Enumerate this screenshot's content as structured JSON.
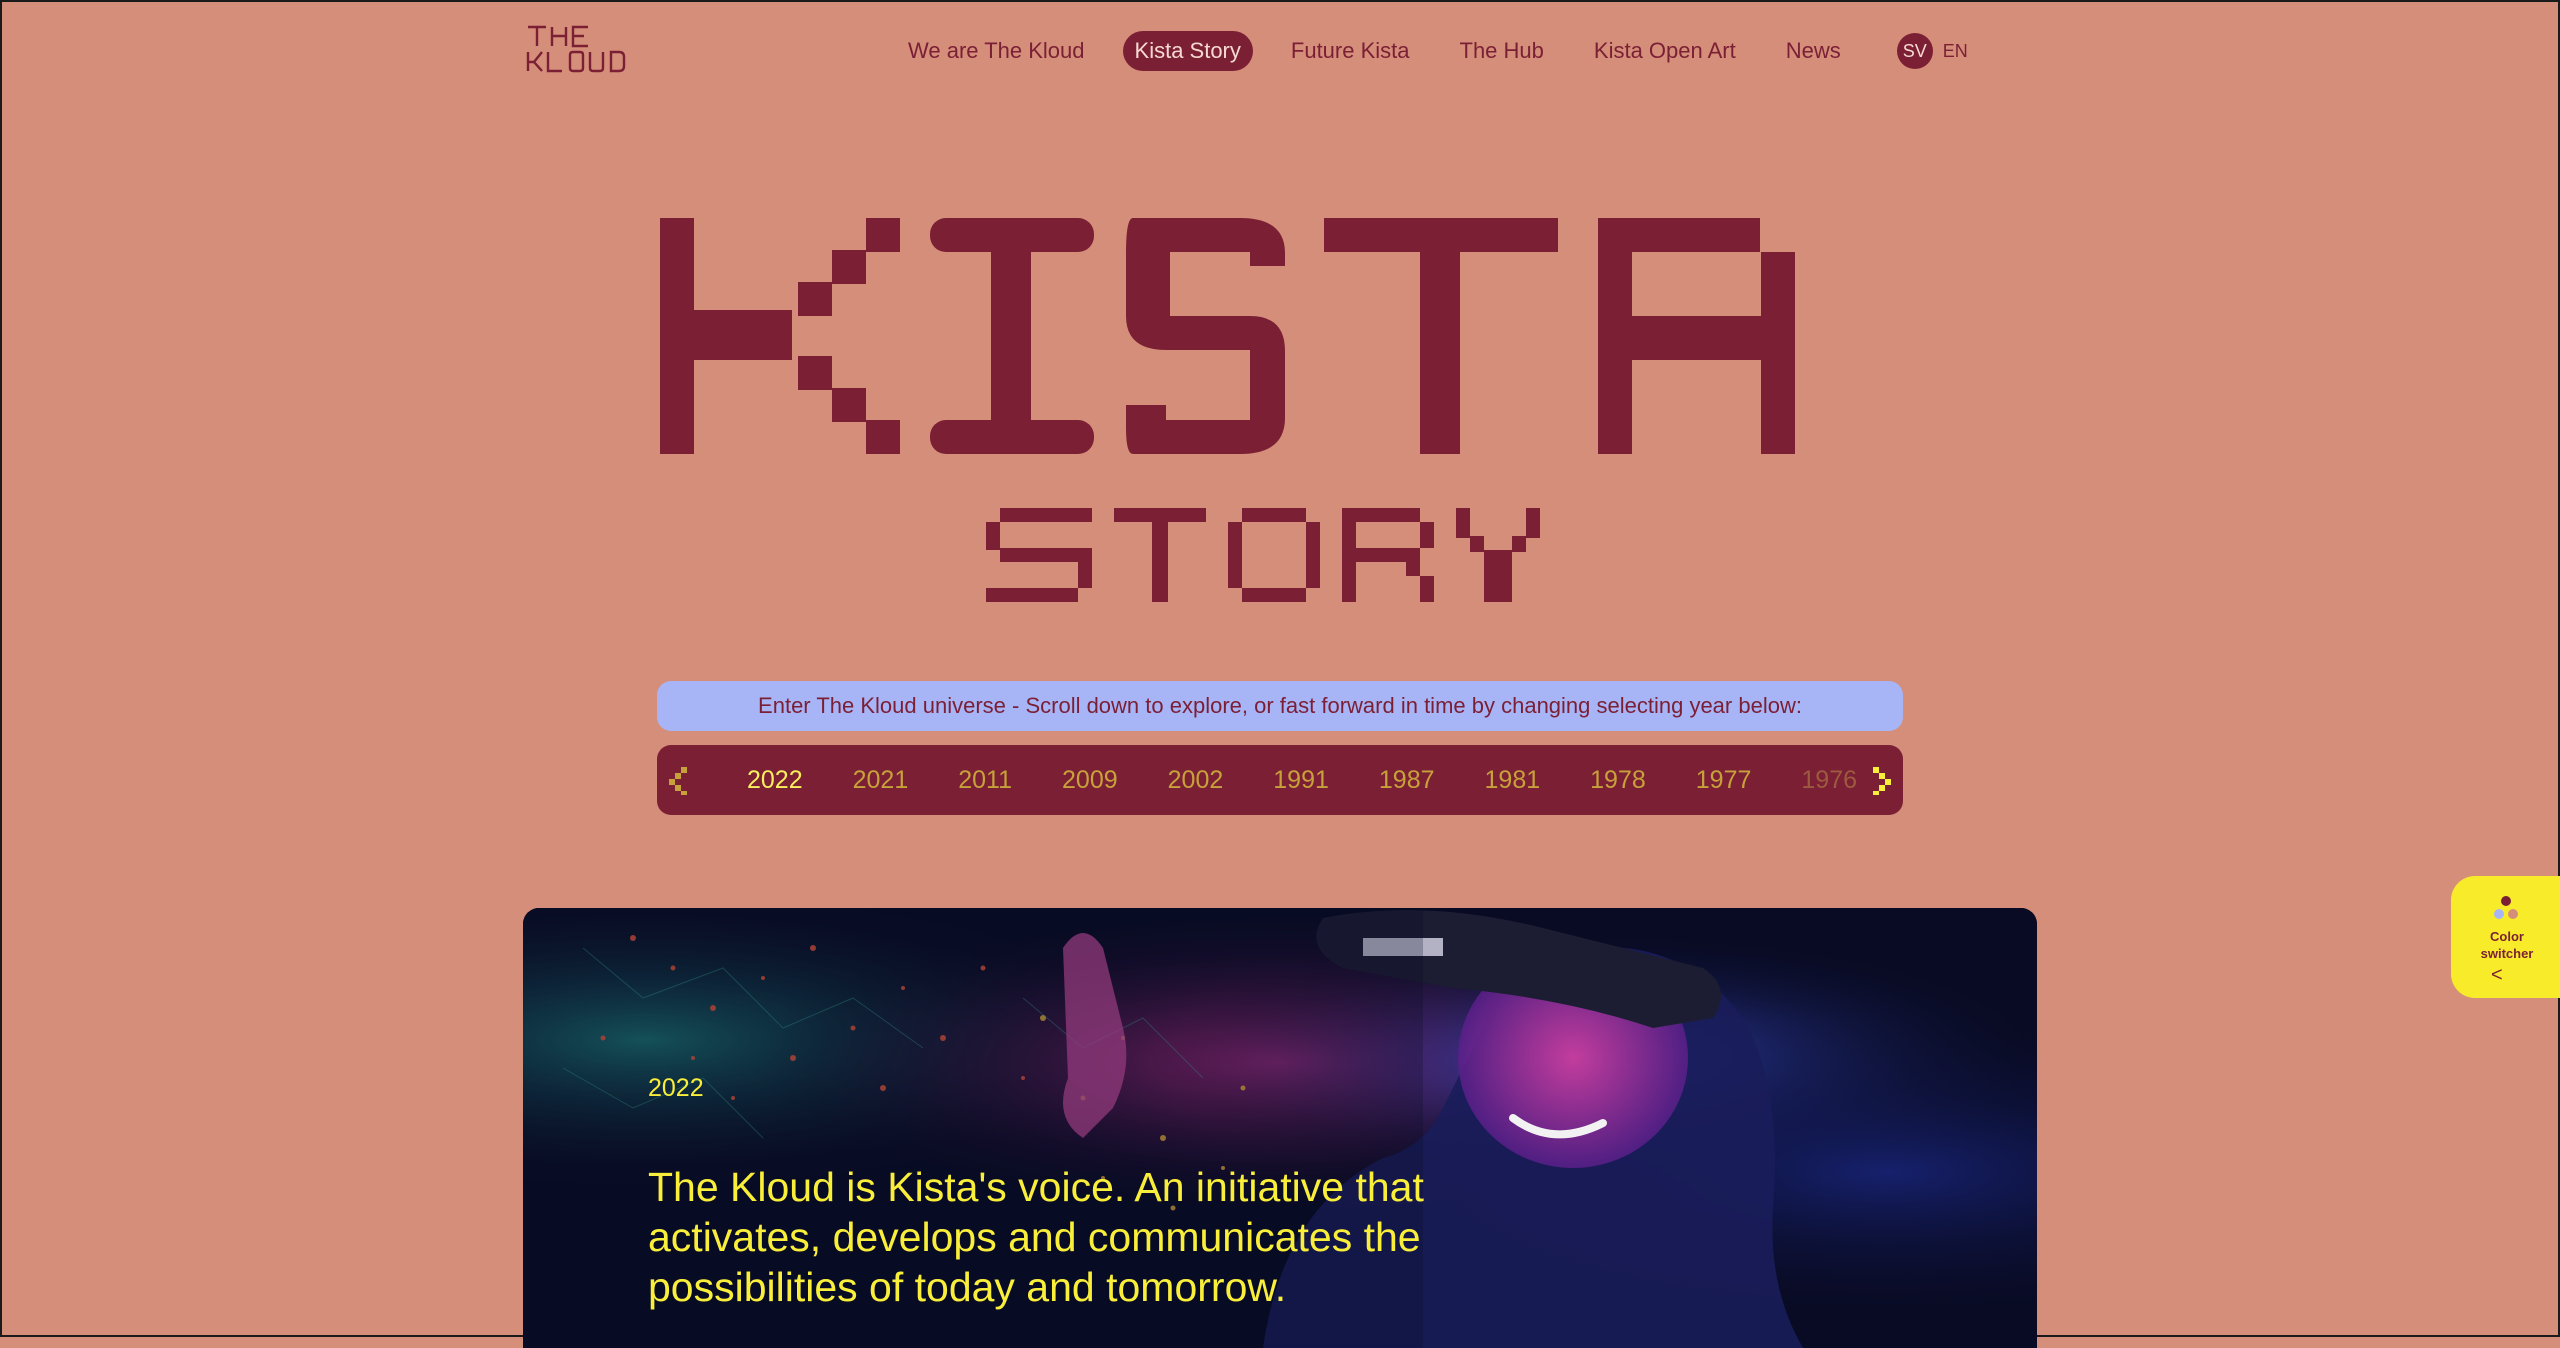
{
  "brand": {
    "logo_line1": "THE",
    "logo_line2": "KLOUD"
  },
  "nav": {
    "items": [
      {
        "label": "We are The Kloud",
        "active": false
      },
      {
        "label": "Kista Story",
        "active": true
      },
      {
        "label": "Future Kista",
        "active": false
      },
      {
        "label": "The Hub",
        "active": false
      },
      {
        "label": "Kista Open Art",
        "active": false
      },
      {
        "label": "News",
        "active": false
      }
    ],
    "lang_sv": "SV",
    "lang_en": "EN"
  },
  "hero": {
    "title_line1": "KISTA",
    "title_line2": "STORY"
  },
  "intro": {
    "text": "Enter The Kloud universe - Scroll down to explore, or fast forward in time by changing selecting year below:"
  },
  "timeline": {
    "prev_icon": "chevron-left-icon",
    "next_icon": "chevron-right-icon",
    "years": [
      "2022",
      "2021",
      "2011",
      "2009",
      "2002",
      "1991",
      "1987",
      "1981",
      "1978",
      "1977",
      "1976"
    ],
    "selected": "2022"
  },
  "feature": {
    "year": "2022",
    "text": "The Kloud is Kista's voice. An initiative that activates, develops and communicates the possibilities of today and tomorrow.",
    "image_icon": "vr-headset-woman-image"
  },
  "color_switcher": {
    "label": "Color switcher",
    "arrow": "<",
    "icon": "palette-dots-icon"
  },
  "colors": {
    "background": "#d48e79",
    "accent": "#7b1f35",
    "highlight": "#f9ee3a",
    "intro_bg": "#a7b5f7"
  }
}
